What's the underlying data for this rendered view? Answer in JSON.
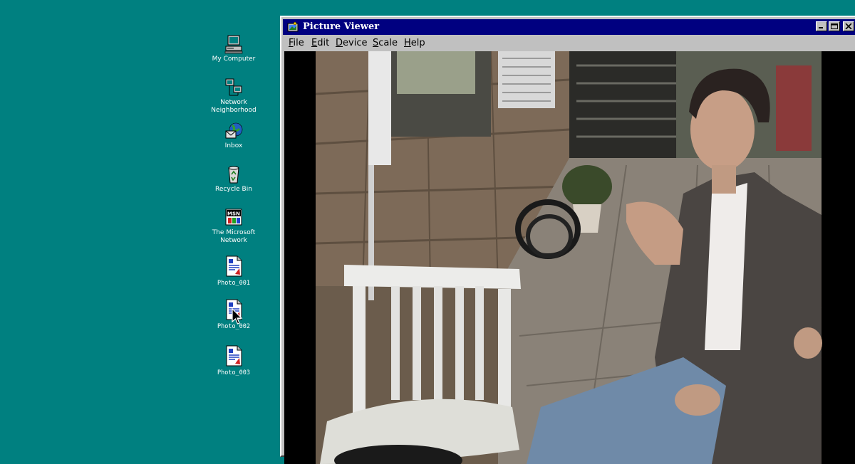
{
  "desktop": {
    "icons": [
      {
        "label": "My Computer"
      },
      {
        "label": "Network Neighborhood"
      },
      {
        "label": "Inbox"
      },
      {
        "label": "Recycle Bin"
      },
      {
        "label": "The Microsoft Network"
      },
      {
        "label": "Photo_001"
      },
      {
        "label": "Photo_002"
      },
      {
        "label": "Photo_003"
      }
    ]
  },
  "window": {
    "title": "Picture Viewer",
    "menu": [
      {
        "label": "File"
      },
      {
        "label": "Edit"
      },
      {
        "label": "Device"
      },
      {
        "label": "Scale"
      },
      {
        "label": "Help"
      }
    ]
  },
  "colors": {
    "desktop": "#008080",
    "titlebar": "#000080",
    "chrome": "#c0c0c0"
  }
}
